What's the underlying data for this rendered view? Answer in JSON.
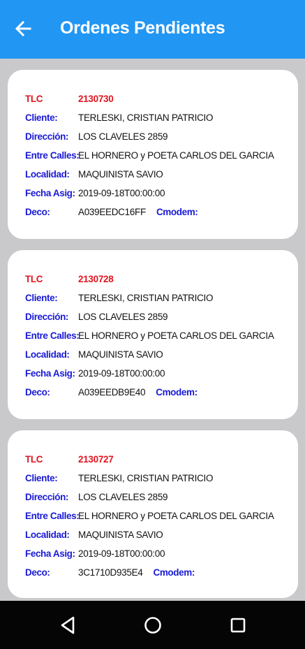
{
  "app": {
    "title": "Ordenes Pendientes"
  },
  "labels": {
    "tlc": "TLC",
    "cliente": "Cliente:",
    "direccion": "Dirección:",
    "entre_calles": "Entre Calles:",
    "localidad": "Localidad:",
    "fecha_asig": "Fecha Asig:",
    "deco": "Deco:",
    "cmodem": "Cmodem:"
  },
  "orders": [
    {
      "tlc": "2130730",
      "cliente": "TERLESKI, CRISTIAN PATRICIO",
      "direccion": "LOS CLAVELES 2859",
      "entre_calles": "EL HORNERO y POETA CARLOS DEL GARCIA",
      "localidad": "MAQUINISTA SAVIO",
      "fecha_asig": "2019-09-18T00:00:00",
      "deco": "A039EEDC16FF",
      "cmodem": ""
    },
    {
      "tlc": "2130728",
      "cliente": "TERLESKI, CRISTIAN PATRICIO",
      "direccion": "LOS CLAVELES 2859",
      "entre_calles": "EL HORNERO y POETA CARLOS DEL GARCIA",
      "localidad": "MAQUINISTA SAVIO",
      "fecha_asig": "2019-09-18T00:00:00",
      "deco": "A039EEDB9E40",
      "cmodem": ""
    },
    {
      "tlc": "2130727",
      "cliente": "TERLESKI, CRISTIAN PATRICIO",
      "direccion": "LOS CLAVELES 2859",
      "entre_calles": "EL HORNERO y POETA CARLOS DEL GARCIA",
      "localidad": "MAQUINISTA SAVIO",
      "fecha_asig": "2019-09-18T00:00:00",
      "deco": "3C1710D935E4",
      "cmodem": ""
    }
  ],
  "icons": {
    "back": "arrow-left-icon",
    "nav_back": "triangle-back-icon",
    "nav_home": "circle-home-icon",
    "nav_recents": "square-recents-icon"
  },
  "colors": {
    "appbar": "#2196f3",
    "label": "#1a1ad6",
    "tlc": "#e0141e",
    "background": "#c9c9cb",
    "navbar": "#050505"
  }
}
